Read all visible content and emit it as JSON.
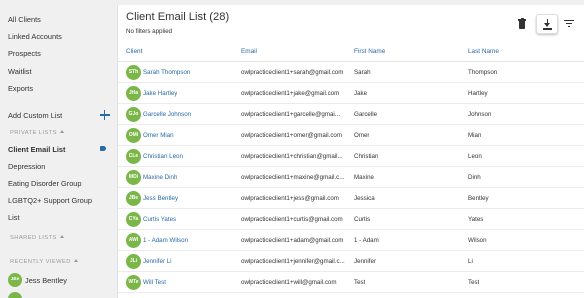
{
  "sidebar": {
    "items": [
      {
        "label": "All Clients"
      },
      {
        "label": "Linked Accounts"
      },
      {
        "label": "Prospects"
      },
      {
        "label": "Waitlist"
      },
      {
        "label": "Exports"
      }
    ],
    "add_custom_list": "Add Custom List",
    "private_lists_heading": "PRIVATE LISTS",
    "private_lists": [
      {
        "label": "Client Email List"
      },
      {
        "label": "Depression"
      },
      {
        "label": "Eating Disorder Group"
      },
      {
        "label": "LGBTQ2+ Support Group"
      },
      {
        "label": "List"
      }
    ],
    "shared_lists_heading": "SHARED LISTS",
    "recently_viewed_heading": "RECENTLY VIEWED",
    "recently_viewed": [
      {
        "initials": "JBe",
        "name": "Jess Bentley"
      }
    ]
  },
  "main": {
    "title": "Client Email List (28)",
    "subtitle": "No filters applied",
    "columns": [
      "Client",
      "Email",
      "First Name",
      "Last Name"
    ],
    "rows": [
      {
        "initials": "STh",
        "client": "Sarah Thompson",
        "email": "owlpracticeclient1+sarah@gmail.com",
        "first": "Sarah",
        "last": "Thompson"
      },
      {
        "initials": "JHa",
        "client": "Jake Hartley",
        "email": "owlpracticeclient1+jake@gmail.com",
        "first": "Jake",
        "last": "Hartley"
      },
      {
        "initials": "GJo",
        "client": "Garcelle Johnson",
        "email": "owlpracticeclient1+garcelle@gmai...",
        "first": "Garcelle",
        "last": "Johnson"
      },
      {
        "initials": "OMi",
        "client": "Omer Mian",
        "email": "owlpracticeclient1+omer@gmail.com",
        "first": "Omer",
        "last": "Mian"
      },
      {
        "initials": "CLe",
        "client": "Christian Leon",
        "email": "owlpracticeclient1+christian@gmail...",
        "first": "Christian",
        "last": "Leon"
      },
      {
        "initials": "MDi",
        "client": "Maxine Dinh",
        "email": "owlpracticeclient1+maxine@gmail.c...",
        "first": "Maxine",
        "last": "Dinh"
      },
      {
        "initials": "JBe",
        "client": "Jess Bentley",
        "email": "owlpracticeclient1+jess@gmail.com",
        "first": "Jessica",
        "last": "Bentley"
      },
      {
        "initials": "CYa",
        "client": "Curtis Yates",
        "email": "owlpracticeclient1+curtis@gmail.com",
        "first": "Curtis",
        "last": "Yates"
      },
      {
        "initials": "AWi",
        "client": "1 - Adam Wilson",
        "email": "owlpracticeclient1+adam@gmail.com",
        "first": "1 - Adam",
        "last": "Wilson"
      },
      {
        "initials": "JLi",
        "client": "Jennifer Li",
        "email": "owlpracticeclient1+jennifer@gmail.c...",
        "first": "Jennifer",
        "last": "Li"
      },
      {
        "initials": "WTe",
        "client": "Will Test",
        "email": "owlpracticeclient1+will@gmail.com",
        "first": "Test",
        "last": "Test"
      }
    ]
  },
  "colors": {
    "accent": "#2b6aa8",
    "avatar": "#7ab648",
    "sidebar_bg": "#f0f0f0"
  },
  "icons": [
    "plus-icon",
    "tag-icon",
    "trash-icon",
    "download-icon",
    "filter-icon",
    "caret-up-icon"
  ]
}
